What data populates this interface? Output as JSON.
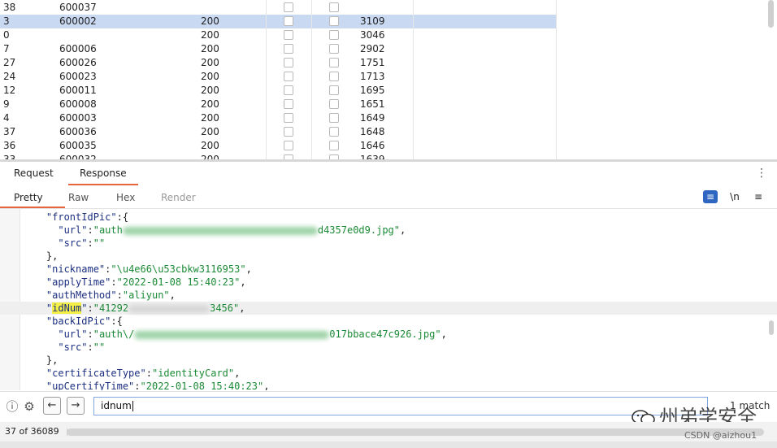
{
  "results": {
    "rows": [
      {
        "num": "38",
        "payload": "600037",
        "status": "",
        "length": ""
      },
      {
        "num": "3",
        "payload": "600002",
        "status": "200",
        "length": "3109"
      },
      {
        "num": "0",
        "payload": "",
        "status": "200",
        "length": "3046"
      },
      {
        "num": "7",
        "payload": "600006",
        "status": "200",
        "length": "2902"
      },
      {
        "num": "27",
        "payload": "600026",
        "status": "200",
        "length": "1751"
      },
      {
        "num": "24",
        "payload": "600023",
        "status": "200",
        "length": "1713"
      },
      {
        "num": "12",
        "payload": "600011",
        "status": "200",
        "length": "1695"
      },
      {
        "num": "9",
        "payload": "600008",
        "status": "200",
        "length": "1651"
      },
      {
        "num": "4",
        "payload": "600003",
        "status": "200",
        "length": "1649"
      },
      {
        "num": "37",
        "payload": "600036",
        "status": "200",
        "length": "1648"
      },
      {
        "num": "36",
        "payload": "600035",
        "status": "200",
        "length": "1646"
      },
      {
        "num": "33",
        "payload": "600032",
        "status": "200",
        "length": "1639"
      }
    ],
    "selected_row": 1
  },
  "panel_tabs": {
    "request": "Request",
    "response": "Response",
    "active": "Response"
  },
  "view_tabs": {
    "pretty": "Pretty",
    "raw": "Raw",
    "hex": "Hex",
    "render": "Render",
    "active": "Pretty"
  },
  "toolbar_icons": {
    "wrap": "wrap-lines-icon",
    "newline": "\\n",
    "menu": "menu-icon"
  },
  "editor_lines": [
    {
      "indent": "    ",
      "key": "\"frontIdPic\"",
      "rest": ":{"
    },
    {
      "indent": "      ",
      "key": "\"url\"",
      "rest": ":",
      "str_a": "\"auth",
      "str_b": "d4357e0d9.jpg\"",
      "tail": ","
    },
    {
      "indent": "      ",
      "key": "\"src\"",
      "rest": ":",
      "str": "\"\""
    },
    {
      "indent": "    ",
      "plain": "},"
    },
    {
      "indent": "    ",
      "key": "\"nickname\"",
      "rest": ":",
      "str": "\"\\u4e66\\u53cbkw3116953\"",
      "tail": ","
    },
    {
      "indent": "    ",
      "key": "\"applyTime\"",
      "rest": ":",
      "str": "\"2022-01-08 15:40:23\"",
      "tail": ","
    },
    {
      "indent": "    ",
      "key": "\"authMethod\"",
      "rest": ":",
      "str": "\"aliyun\"",
      "tail": ","
    },
    {
      "indent": "    ",
      "key_pre": "\"",
      "key_mark": "idNum",
      "key_post": "\"",
      "rest": ":",
      "str_a": "\"41292",
      "str_b": "3456\"",
      "tail": ","
    },
    {
      "indent": "    ",
      "key": "\"backIdPic\"",
      "rest": ":{"
    },
    {
      "indent": "      ",
      "key": "\"url\"",
      "rest": ":",
      "str_a": "\"auth\\/",
      "str_b": "017bbace47c926.jpg\"",
      "tail": ","
    },
    {
      "indent": "      ",
      "key": "\"src\"",
      "rest": ":",
      "str": "\"\""
    },
    {
      "indent": "    ",
      "plain": "},"
    },
    {
      "indent": "    ",
      "key": "\"certificateType\"",
      "rest": ":",
      "str": "\"identityCard\"",
      "tail": ","
    },
    {
      "indent": "    ",
      "key": "\"upCertifyTime\"",
      "rest": ":",
      "str": "\"2022-01-08 15:40:23\"",
      "tail": ","
    }
  ],
  "highlighted_line": 7,
  "search": {
    "value": "idnum",
    "match_label": "1 match"
  },
  "status": {
    "count": "37 of 36089",
    "progress": 0.001
  },
  "watermark": {
    "text": "州弟学安全",
    "credit": "CSDN @aizhou1"
  },
  "colors": {
    "accent": "#e8643c",
    "selection": "#c9d9f2",
    "key": "#1c2f80",
    "string": "#1b8a36",
    "highlight": "#f4ef46"
  }
}
